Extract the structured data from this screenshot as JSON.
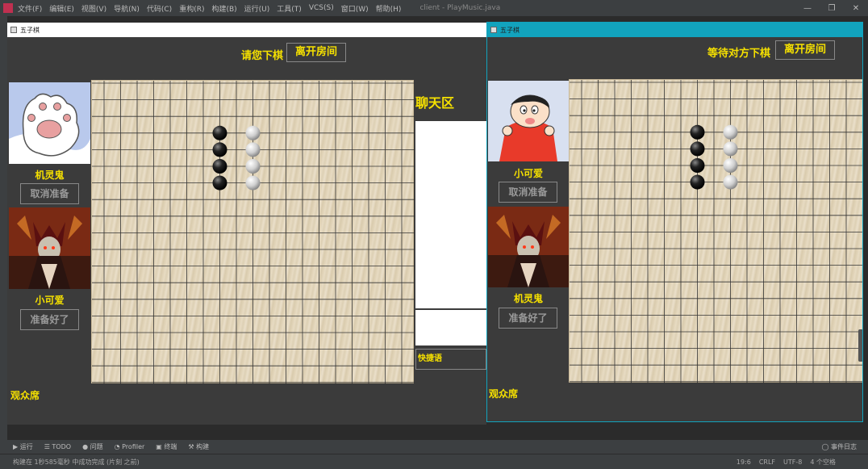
{
  "ide": {
    "menu": [
      "文件(F)",
      "编辑(E)",
      "视图(V)",
      "导航(N)",
      "代码(C)",
      "重构(R)",
      "构建(B)",
      "运行(U)",
      "工具(T)",
      "VCS(S)",
      "窗口(W)",
      "帮助(H)"
    ],
    "file_title": "client - PlayMusic.java",
    "window_controls": [
      "—",
      "❐",
      "✕"
    ],
    "bottom_tools": [
      "运行",
      "TODO",
      "问题",
      "Profiler",
      "终端",
      "构建"
    ],
    "event_log": "事件日志",
    "status_left": "构建在 1秒585毫秒 中成功完成 (片刻 之前)",
    "status_right": [
      "19:6",
      "CRLF",
      "UTF-8",
      "4 个空格"
    ]
  },
  "windows": [
    {
      "title": "五子棋",
      "status": "请您下棋",
      "leave_button": "离开房间",
      "players": [
        {
          "name": "机灵鬼",
          "button": "取消准备",
          "avatar": "paw-avatar"
        },
        {
          "name": "小可爱",
          "button": "准备好了",
          "avatar": "demon-avatar"
        }
      ],
      "chat_title": "聊天区",
      "quick_phrase": "快捷语",
      "spectators": "观众席"
    },
    {
      "title": "五子棋",
      "status": "等待对方下棋",
      "leave_button": "离开房间",
      "players": [
        {
          "name": "小可爱",
          "button": "取消准备",
          "avatar": "cartoon-boy-avatar"
        },
        {
          "name": "机灵鬼",
          "button": "准备好了",
          "avatar": "demon-avatar"
        }
      ],
      "spectators": "观众席"
    }
  ],
  "stones": {
    "black": [
      [
        7,
        3
      ],
      [
        7,
        4
      ],
      [
        7,
        5
      ],
      [
        7,
        6
      ]
    ],
    "white": [
      [
        9,
        3
      ],
      [
        9,
        4
      ],
      [
        9,
        5
      ],
      [
        9,
        6
      ]
    ]
  },
  "colors": {
    "accent": "#f5e000",
    "ide_bg": "#2b2b2b",
    "window_bg": "#3b3b3b",
    "active_title": "#12a3bd"
  }
}
